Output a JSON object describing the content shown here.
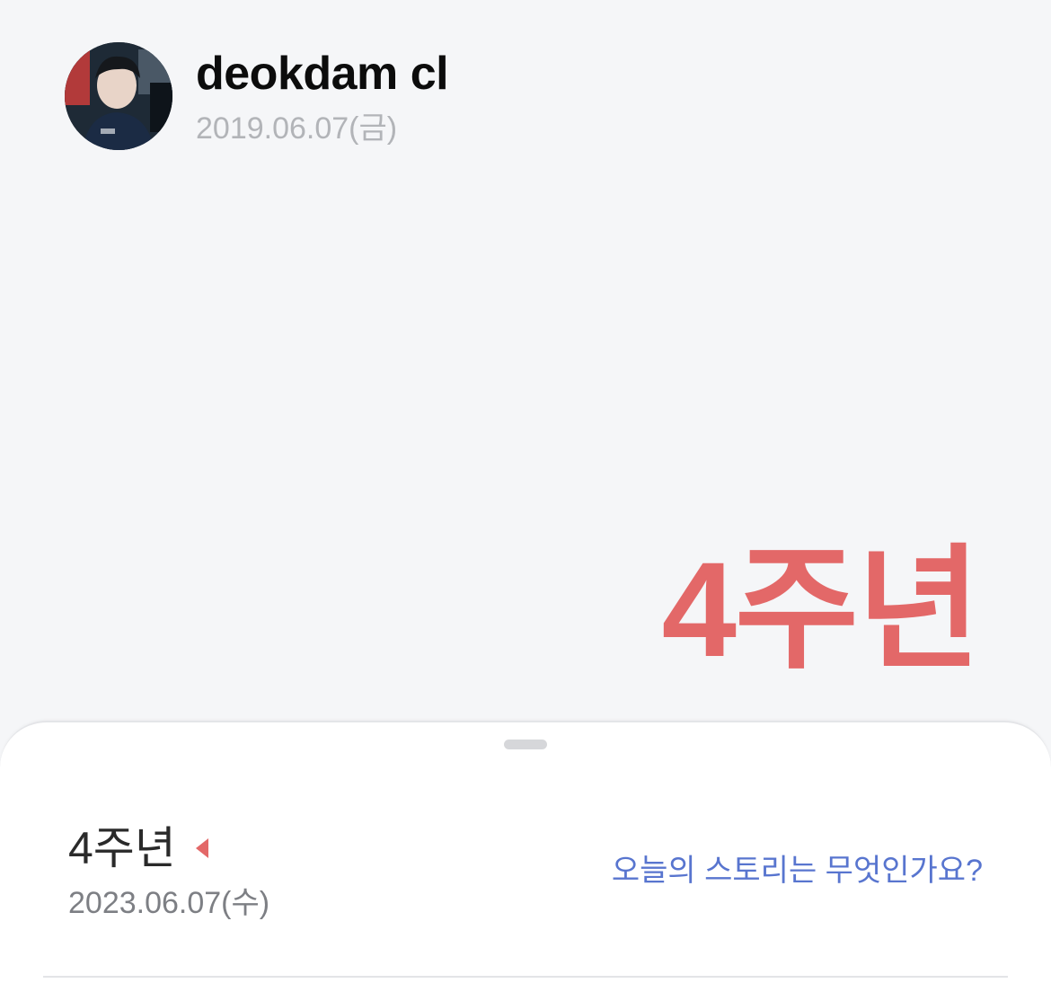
{
  "profile": {
    "name": "deokdam cl",
    "start_date": "2019.06.07(금)"
  },
  "headline": {
    "anniversary": "4주년"
  },
  "sheet": {
    "title": "4주년",
    "date": "2023.06.07(수)",
    "story_prompt": "오늘의 스토리는 무엇인가요?"
  },
  "colors": {
    "accent": "#e36868",
    "link": "#5875cf",
    "background": "#f5f6f8"
  }
}
